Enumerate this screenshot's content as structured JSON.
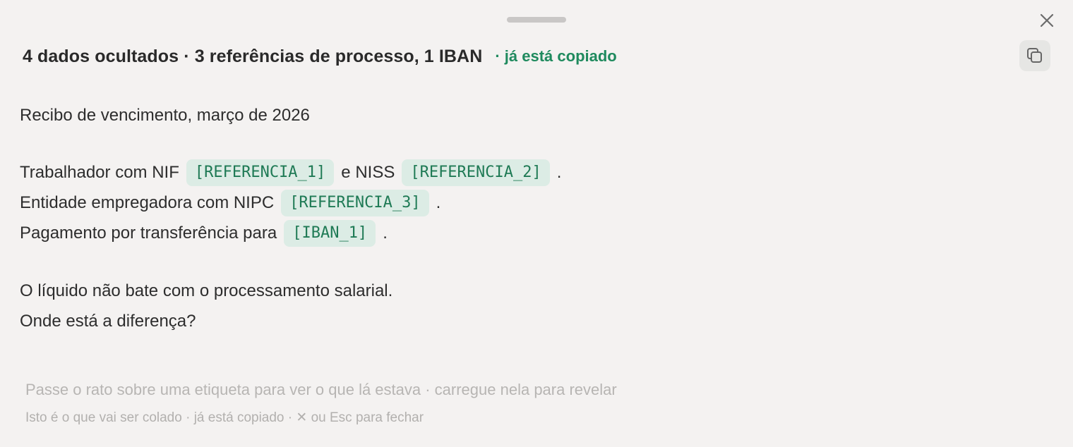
{
  "window": {
    "close_icon": "close-icon",
    "copy_icon": "copy-icon",
    "handle_color": "#c9c7c6"
  },
  "header": {
    "title": "4 dados ocultados · 3 referências de processo, 1 IBAN",
    "status": "· já está copiado",
    "status_color": "#1f8a5e"
  },
  "document": {
    "line1": "Recibo de vencimento, março de 2026",
    "line2": {
      "text_a": "Trabalhador com NIF",
      "tag_a": "[REFERENCIA_1]",
      "text_b": "e NISS",
      "tag_b": "[REFERENCIA_2]",
      "text_c": "."
    },
    "line3": {
      "text_a": "Entidade empregadora com NIPC",
      "tag_a": "[REFERENCIA_3]",
      "text_b": "."
    },
    "line4": {
      "text_a": "Pagamento por transferência para",
      "tag_a": "[IBAN_1]",
      "text_b": "."
    },
    "line5": "O líquido não bate com o processamento salarial.",
    "line6": "Onde está a diferença?"
  },
  "footer": {
    "hint": "Passe o rato sobre uma etiqueta para ver o que lá estava · carregue nela para revelar",
    "sub": "Isto é o que vai ser colado · já está copiado · ✕ ou Esc para fechar"
  },
  "colors": {
    "tag_bg": "#dcece5",
    "tag_text": "#1f7a55",
    "background": "#f4f2f1"
  }
}
